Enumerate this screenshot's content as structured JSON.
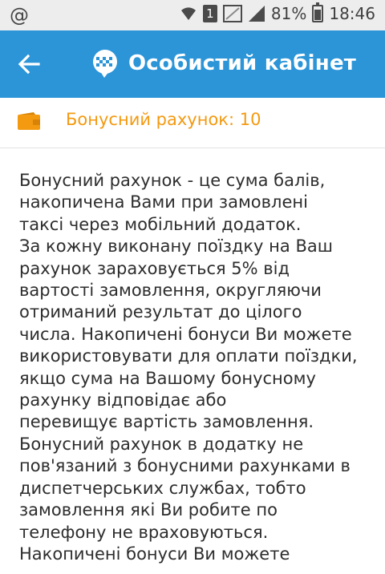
{
  "status_bar": {
    "left_icon": "at-icon",
    "sim_slot": "1",
    "battery": "81%",
    "battery_level": 0.81,
    "time": "18:46"
  },
  "app_bar": {
    "back_icon": "arrow-left-icon",
    "logo_icon": "taxi-chat-icon",
    "title": "Особистий кабінет",
    "color": "#2b95d8"
  },
  "bonus": {
    "icon": "wallet-icon",
    "label": "Бонусний рахунок: 10",
    "color": "#f39a11"
  },
  "content": {
    "text": "Бонусний рахунок - це сума балів,\nнакопичена Вами при замовлені\nтаксі         через мобільний додаток.\nЗа кожну виконану поїздку на Ваш\nрахунок зараховується 5% від\nвартості замовлення, округляючи\nотриманий         результат до цілого\nчисла. Накопичені бонуси Ви можете\nвикористовувати для оплати поїздки,\nякщо сума на Вашому бонусному\nрахунку         відповідає або\nперевищує вартість замовлення.\nБонусний рахунок в додатку не\nпов'язаний з бонусними рахунками в\nдиспетчерських службах,         тобто\nзамовлення які Ви робите по\nтелефону не враховуються.\nНакопичені бонуси Ви можете"
  }
}
